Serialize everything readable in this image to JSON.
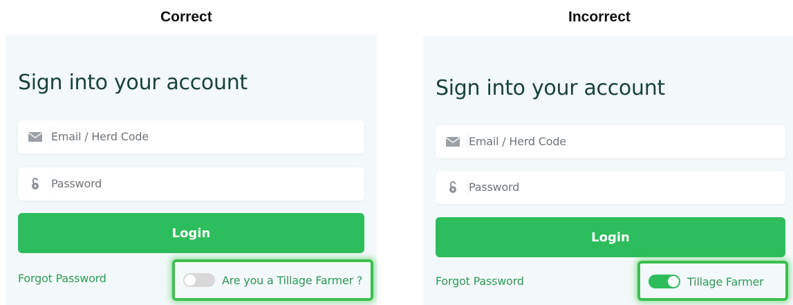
{
  "headings": {
    "correct": "Correct",
    "incorrect": "Incorrect"
  },
  "panels": [
    {
      "variant": "correct",
      "title": "Sign into your account",
      "email_placeholder": "Email / Herd Code",
      "password_placeholder": "Password",
      "login_label": "Login",
      "forgot_label": "Forgot Password",
      "toggle_label": "Are you a Tillage Farmer ?",
      "toggle_state": "off"
    },
    {
      "variant": "incorrect",
      "title": "Sign into your account",
      "email_placeholder": "Email / Herd Code",
      "password_placeholder": "Password",
      "login_label": "Login",
      "forgot_label": "Forgot Password",
      "toggle_label": "Tillage Farmer",
      "toggle_state": "on"
    }
  ],
  "icons": {
    "email": "envelope-icon",
    "password": "padlock-icon"
  },
  "colors": {
    "brand_green": "#2dbd5c",
    "link_green": "#2e9a56",
    "title_color": "#17423a",
    "highlight": "#3bbf4f",
    "panel_bg": "#f3f8fb"
  }
}
